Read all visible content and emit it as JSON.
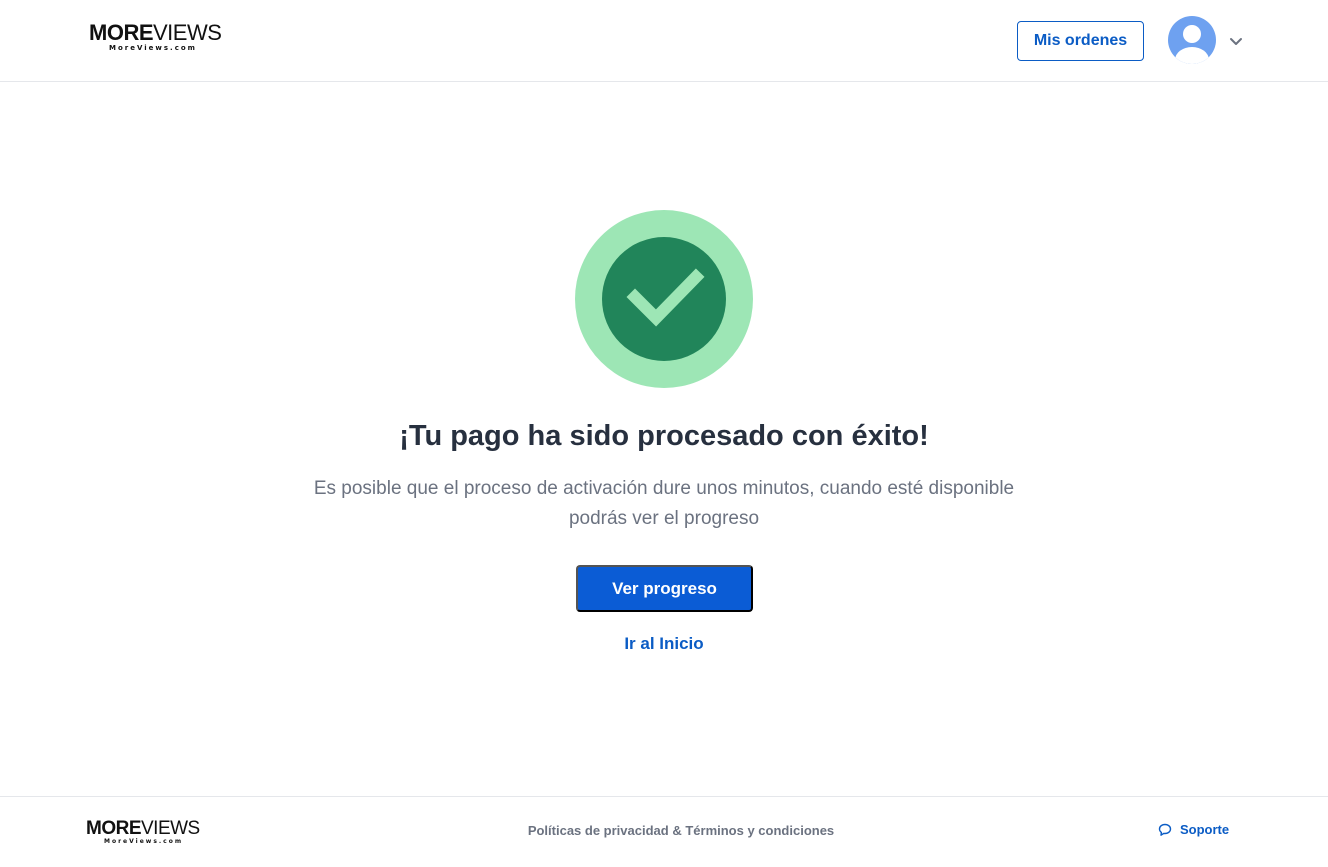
{
  "header": {
    "logo": {
      "main_bold": "MORE",
      "main_thin": "VIEWS",
      "sub": "MoreViews.com"
    },
    "orders_label": "Mis ordenes",
    "avatar_icon": "user-avatar-icon",
    "chevron_icon": "chevron-down-icon"
  },
  "main": {
    "status_icon": "check-circle-icon",
    "title": "¡Tu pago ha sido procesado con éxito!",
    "description_line1": "Es posible que el proceso de activación dure unos minutos, cuando esté disponible",
    "description_line2": "podrás ver el progreso",
    "primary_button": "Ver progreso",
    "home_link": "Ir al Inicio"
  },
  "footer": {
    "logo": {
      "main_bold": "MORE",
      "main_thin": "VIEWS",
      "sub": "MoreViews.com"
    },
    "privacy_link": "Políticas de privacidad",
    "separator": "&",
    "terms_link": "Términos y condiciones",
    "support_label": "Soporte",
    "support_icon": "chat-bubble-icon"
  },
  "colors": {
    "accent": "#0b5cd5",
    "success_outer": "#9de6b5",
    "success_inner": "#21855a",
    "success_check": "#9de6b5",
    "avatar": "#6ea1f0"
  }
}
